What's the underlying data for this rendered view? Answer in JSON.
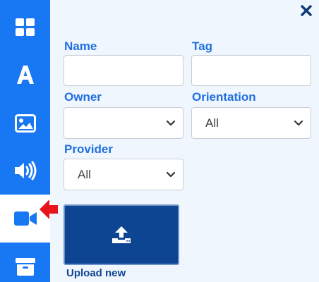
{
  "sidebar": {
    "items": [
      {
        "icon": "grid-icon"
      },
      {
        "icon": "text-icon"
      },
      {
        "icon": "image-icon"
      },
      {
        "icon": "audio-icon"
      },
      {
        "icon": "video-icon",
        "active": true
      },
      {
        "icon": "archive-icon"
      }
    ]
  },
  "form": {
    "name_label": "Name",
    "name_value": "",
    "tag_label": "Tag",
    "tag_value": "",
    "owner_label": "Owner",
    "owner_value": "",
    "orientation_label": "Orientation",
    "orientation_value": "All",
    "provider_label": "Provider",
    "provider_value": "All"
  },
  "upload": {
    "label": "Upload new"
  },
  "colors": {
    "sidebar": "#1877f2",
    "label": "#1f6fe0",
    "upload_tile": "#0e4593",
    "pointer_arrow": "#e8141c"
  }
}
